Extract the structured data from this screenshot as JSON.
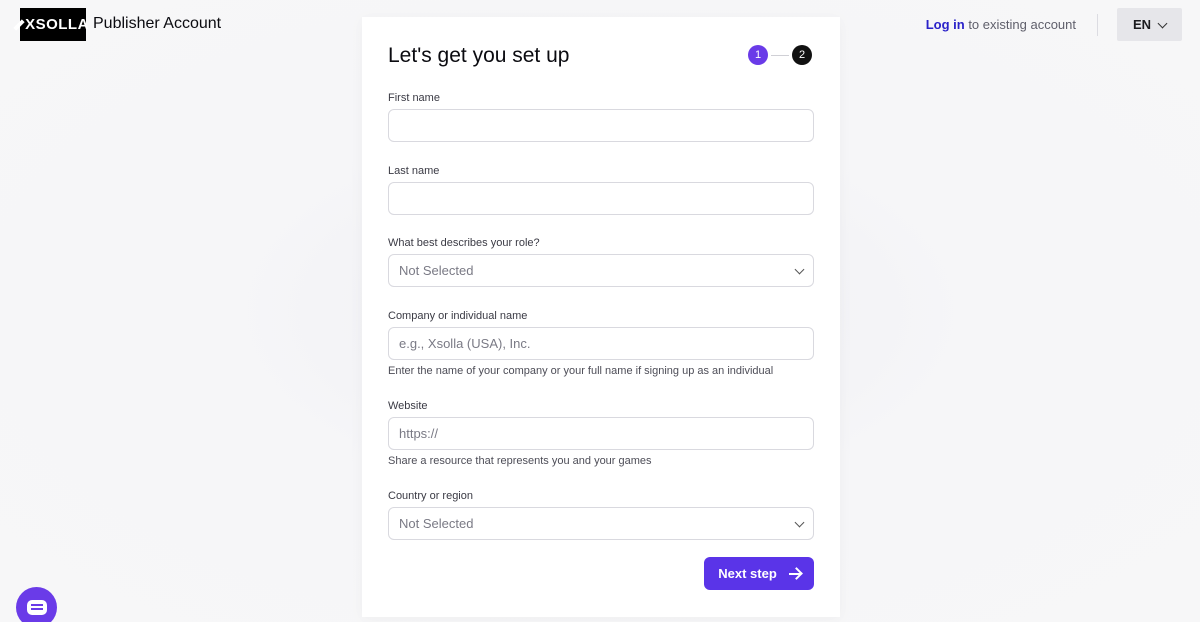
{
  "header": {
    "logo_text": "XSOLLA",
    "product_name": "Publisher Account",
    "login_link": "Log in",
    "login_suffix": " to existing account",
    "language": "EN"
  },
  "form": {
    "title": "Let's get you set up",
    "steps": [
      "1",
      "2"
    ],
    "fields": {
      "first_name": {
        "label": "First name",
        "value": ""
      },
      "last_name": {
        "label": "Last name",
        "value": ""
      },
      "role": {
        "label": "What best describes your role?",
        "value": "Not Selected"
      },
      "company": {
        "label": "Company or individual name",
        "placeholder": "e.g., Xsolla (USA), Inc.",
        "hint": "Enter the name of your company or your full name if signing up as an individual"
      },
      "website": {
        "label": "Website",
        "placeholder": "https://",
        "hint": "Share a resource that represents you and your games"
      },
      "country": {
        "label": "Country or region",
        "value": "Not Selected"
      }
    },
    "next_button": "Next step"
  },
  "colors": {
    "accent": "#5a34e8",
    "link": "#2a22c9",
    "step_inactive": "#111111"
  },
  "icons": {
    "chat": "chat-icon",
    "next": "arrow-right-icon",
    "dropdown": "chevron-down-icon"
  }
}
